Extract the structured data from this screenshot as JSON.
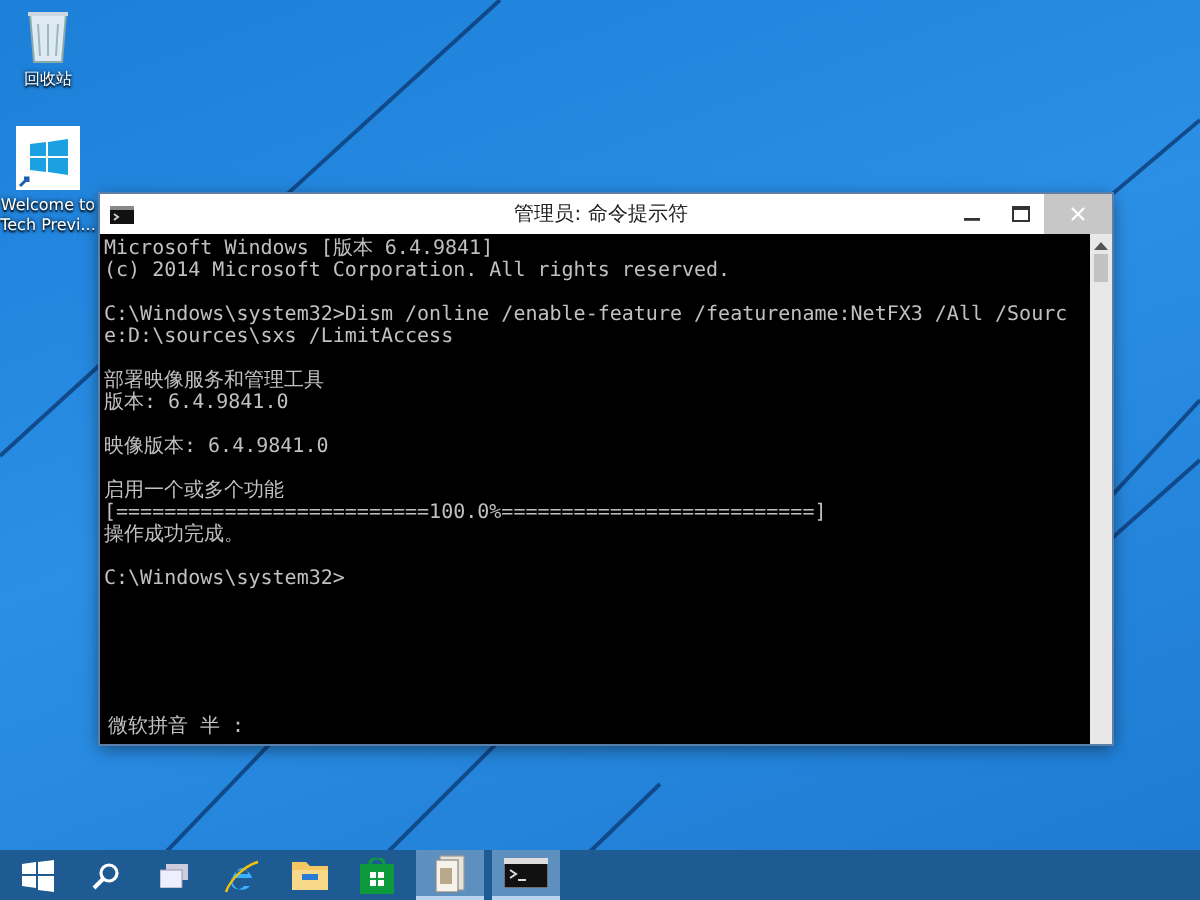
{
  "desktop_icons": [
    {
      "kind": "recycle",
      "label": "回收站"
    },
    {
      "kind": "shortcut",
      "label": "Welcome to Tech Previ..."
    }
  ],
  "console_window": {
    "title": "管理员: 命令提示符",
    "blocks": [
      [
        "Microsoft Windows [版本 6.4.9841]",
        "(c) 2014 Microsoft Corporation. All rights reserved."
      ],
      [
        "C:\\Windows\\system32>Dism /online /enable-feature /featurename:NetFX3 /All /Source:D:\\sources\\sxs /LimitAccess"
      ],
      [
        "部署映像服务和管理工具",
        "版本: 6.4.9841.0"
      ],
      [
        "映像版本: 6.4.9841.0"
      ],
      [
        "启用一个或多个功能",
        "[==========================100.0%==========================]",
        "操作成功完成。"
      ],
      [
        "C:\\Windows\\system32>"
      ]
    ],
    "ime_status": "微软拼音 半 :"
  },
  "taskbar": {
    "items": [
      {
        "kind": "start",
        "active": false
      },
      {
        "kind": "search",
        "active": false
      },
      {
        "kind": "task-view",
        "active": false
      },
      {
        "kind": "browser",
        "active": false
      },
      {
        "kind": "folder",
        "active": false
      },
      {
        "kind": "store",
        "active": false
      },
      {
        "kind": "app",
        "active": true
      },
      {
        "kind": "console",
        "active": true
      }
    ]
  }
}
